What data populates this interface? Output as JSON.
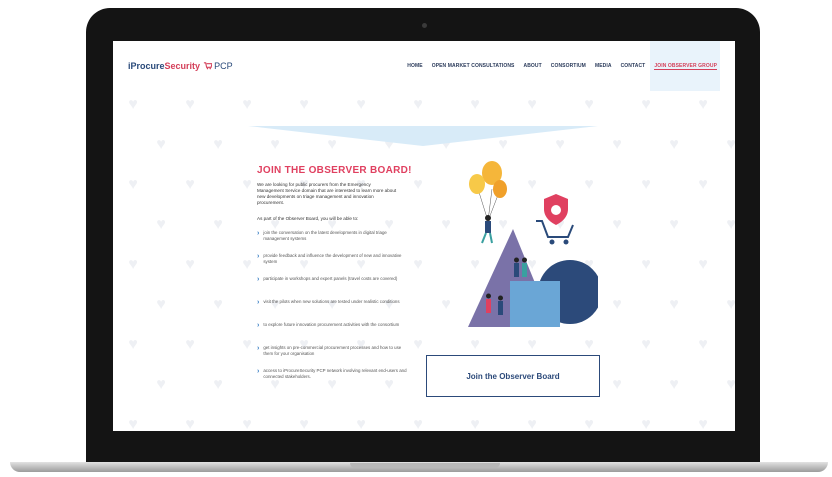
{
  "header": {
    "logo": {
      "part1": "iProcure",
      "part2": "Security",
      "part3": " PCP"
    },
    "nav": [
      {
        "label": "HOME"
      },
      {
        "label": "OPEN MARKET CONSULTATIONS"
      },
      {
        "label": "ABOUT"
      },
      {
        "label": "CONSORTIUM"
      },
      {
        "label": "MEDIA"
      },
      {
        "label": "CONTACT"
      },
      {
        "label": "JOIN OBSERVER GROUP",
        "active": true
      }
    ]
  },
  "main": {
    "title": "JOIN THE OBSERVER BOARD!",
    "intro": "We are looking for public procurers from the Emergency Management Service domain that are interested to learn more about new developments on triage management and innovation procurement.",
    "lead": "As part of the Observer Board, you will be able to:",
    "bullets": [
      "join the conversation on the latest developments in digital triage management systems",
      "provide feedback and influence the development of new and innovative system",
      "participate in workshops and expert panels (travel costs are covered)",
      "visit the pilots when new solutions are tested under realistic conditions",
      "to explore future innovation procurement activities with the consortium",
      "get insights on pre-commercial procurement processes and how to use them for your organisation",
      "access to iProcureSecurity PCP network involving relevant end-users and connected stakeholders."
    ],
    "cta": "Join the Observer Board"
  },
  "colors": {
    "accent": "#e04060",
    "navy": "#2c4a7a",
    "light_blue": "#d8ebf8"
  }
}
